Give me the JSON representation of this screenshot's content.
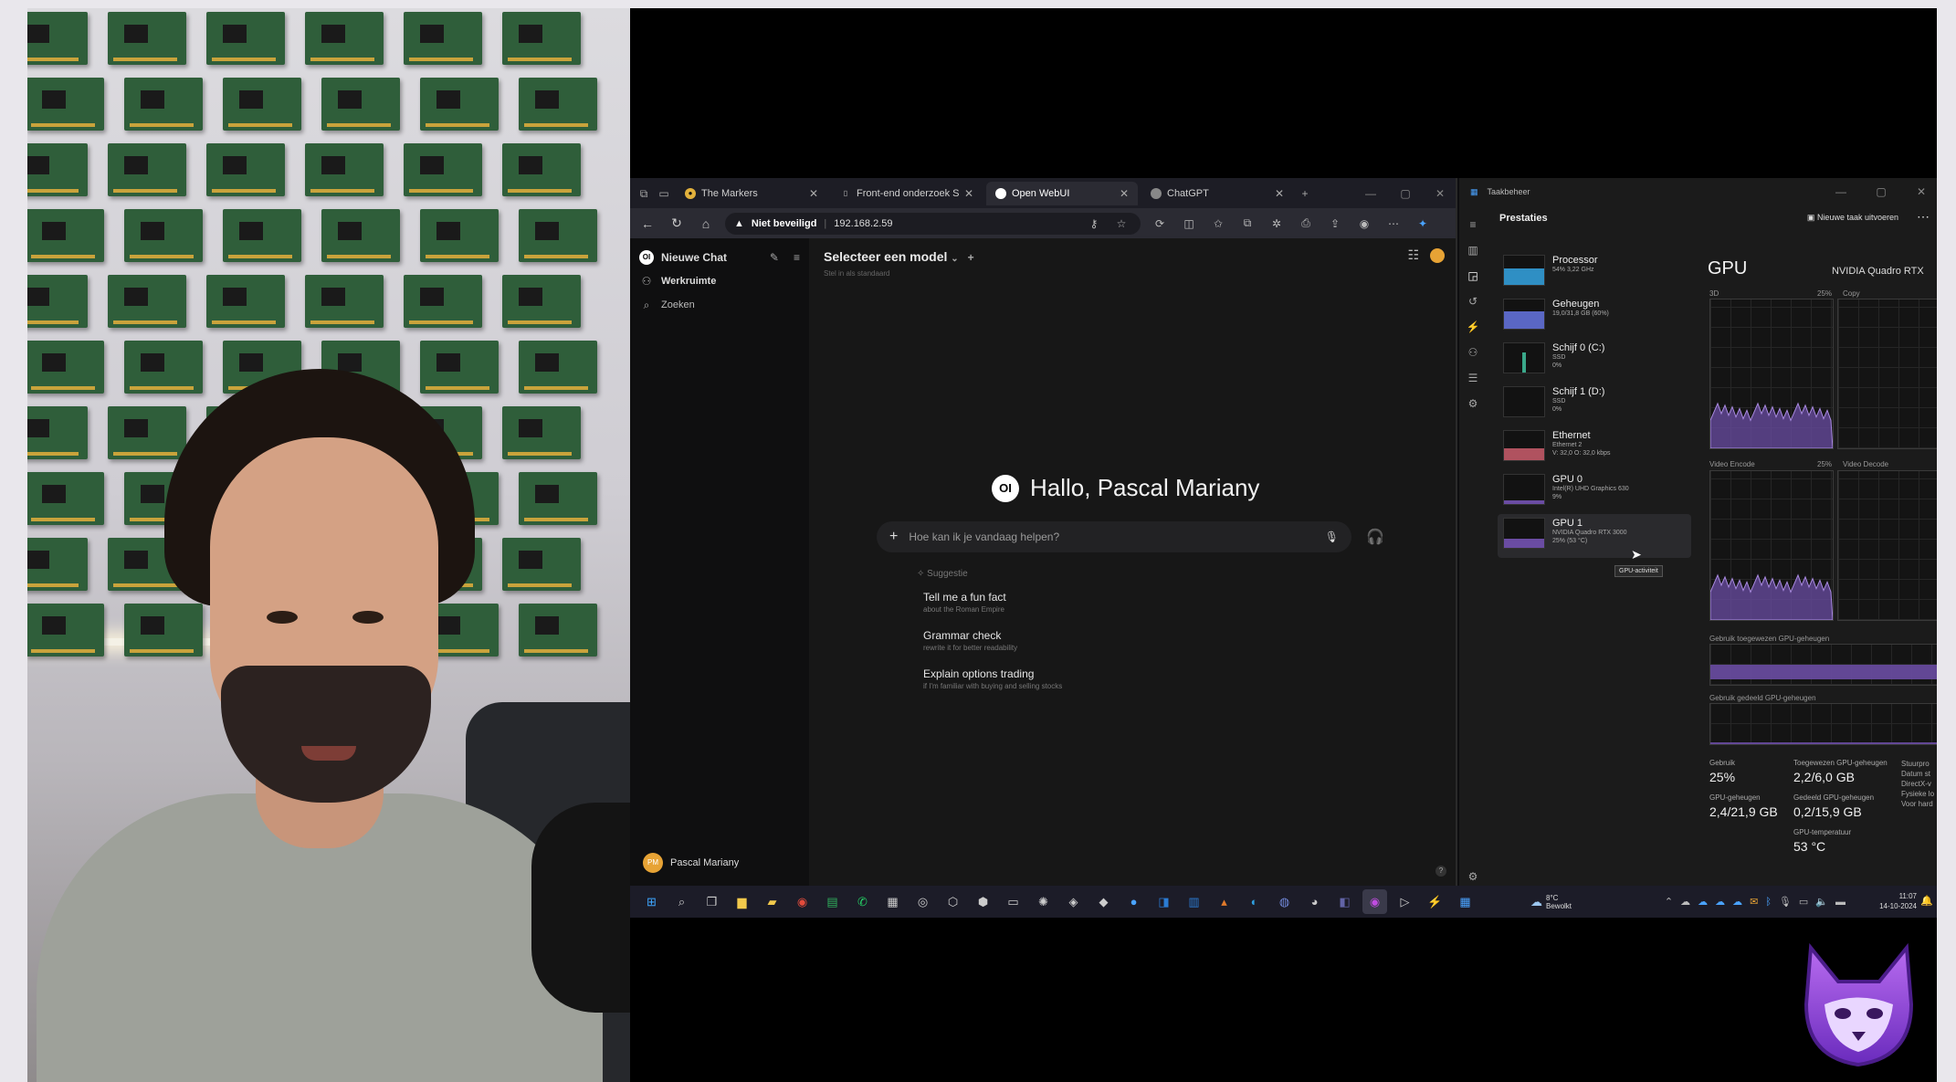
{
  "colors": {
    "accent": "#e7a335",
    "gpu_graph": "#6a4ca3",
    "tab_active": "#2b2b33"
  },
  "browser": {
    "tabs": [
      {
        "label": "The Markers",
        "icon": "markers-favicon",
        "active": false
      },
      {
        "label": "Front-end onderzoek Spectra",
        "icon": "document-icon",
        "active": false
      },
      {
        "label": "Open WebUI",
        "icon": "openwebui-favicon",
        "active": true
      },
      {
        "label": "ChatGPT",
        "icon": "chatgpt-favicon",
        "active": false
      }
    ],
    "security_label": "Niet beveiligd",
    "url": "192.168.2.59"
  },
  "openwebui": {
    "sidebar": {
      "new_chat": "Nieuwe Chat",
      "workspace": "Werkruimte",
      "search": "Zoeken",
      "user_name": "Pascal Mariany",
      "user_initials": "PM"
    },
    "model_selector": "Selecteer een model",
    "model_sub": "Stel in als standaard",
    "logo_text": "OI",
    "greeting": "Hallo, Pascal Mariany",
    "prompt_placeholder": "Hoe kan ik je vandaag helpen?",
    "suggestions_heading": "Suggestie",
    "suggestions": [
      {
        "title": "Tell me a fun fact",
        "sub": "about the Roman Empire"
      },
      {
        "title": "Grammar check",
        "sub": "rewrite it for better readability"
      },
      {
        "title": "Explain options trading",
        "sub": "if I'm familiar with buying and selling stocks"
      }
    ],
    "help": "?"
  },
  "taskmanager": {
    "window_title": "Taakbeheer",
    "header": "Prestaties",
    "new_task": "Nieuwe taak uitvoeren",
    "items": [
      {
        "name": "Processor",
        "detail1": "54% 3,22 GHz",
        "detail2": ""
      },
      {
        "name": "Geheugen",
        "detail1": "19,0/31,8 GB (60%)",
        "detail2": ""
      },
      {
        "name": "Schijf 0 (C:)",
        "detail1": "SSD",
        "detail2": "0%"
      },
      {
        "name": "Schijf 1 (D:)",
        "detail1": "SSD",
        "detail2": "0%"
      },
      {
        "name": "Ethernet",
        "detail1": "Ethernet 2",
        "detail2": "V: 32,0 O: 32,0 kbps"
      },
      {
        "name": "GPU 0",
        "detail1": "Intel(R) UHD Graphics 630",
        "detail2": "9%"
      },
      {
        "name": "GPU 1",
        "detail1": "NVIDIA Quadro RTX 3000",
        "detail2": "25% (53 °C)"
      }
    ],
    "tooltip": "GPU-activiteit",
    "gpu_title": "GPU",
    "gpu_model": "NVIDIA Quadro RTX",
    "graph_labels": {
      "g3d": "3D",
      "g3d_pct": "25%",
      "copy": "Copy",
      "video_encode": "Video Encode",
      "ve_pct": "25%",
      "video_decode": "Video Decode",
      "dedicated": "Gebruik toegewezen GPU-geheugen",
      "shared": "Gebruik gedeeld GPU-geheugen"
    },
    "stats": {
      "usage_label": "Gebruik",
      "usage": "25%",
      "dedicated_label": "Toegewezen GPU-geheugen",
      "dedicated": "2,2/6,0 GB",
      "gpu_mem_label": "GPU-geheugen",
      "gpu_mem": "2,4/21,9 GB",
      "shared_label": "Gedeeld GPU-geheugen",
      "shared": "0,2/15,9 GB",
      "temp_label": "GPU-temperatuur",
      "temp": "53 °C",
      "side_labels": "Stuurpro\nDatum st\nDirectX-v\nFysieke lo\nVoor hard"
    },
    "usage_fraction": 0.25
  },
  "taskbar": {
    "weather_temp": "8°C",
    "weather_desc": "Bewolkt",
    "time": "11:07",
    "date": "14-10-2024"
  }
}
